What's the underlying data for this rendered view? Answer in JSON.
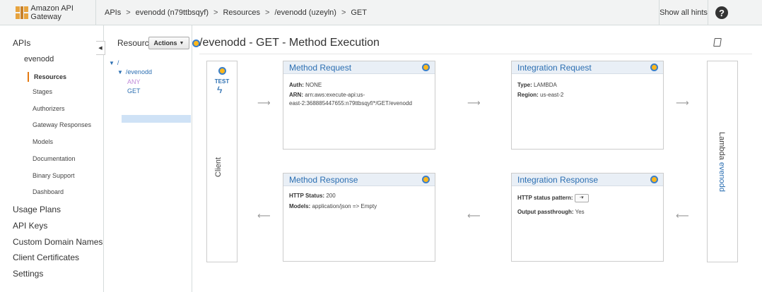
{
  "brand": {
    "name": "Amazon API Gateway",
    "icon": "api-gateway-icon"
  },
  "breadcrumb": [
    {
      "label": "APIs"
    },
    {
      "label": "evenodd (n79ttbsqyf)"
    },
    {
      "label": "Resources"
    },
    {
      "label": "/evenodd (uzeyln)"
    },
    {
      "label": "GET"
    }
  ],
  "breadcrumb_sep": ">",
  "header": {
    "hints_label": "Show all hints",
    "help_label": "?"
  },
  "nav": {
    "apis": "APIs",
    "api_name": "evenodd",
    "items": [
      "Resources",
      "Stages",
      "Authorizers",
      "Gateway Responses",
      "Models",
      "Documentation",
      "Binary Support",
      "Dashboard"
    ],
    "top_items": [
      "Usage Plans",
      "API Keys",
      "Custom Domain Names",
      "Client Certificates",
      "Settings"
    ]
  },
  "resources": {
    "title": "Resources",
    "actions_label": "Actions",
    "tree": {
      "root": "/",
      "child": "/evenodd",
      "methods": [
        "ANY",
        "GET"
      ]
    }
  },
  "main": {
    "title": "/evenodd - GET - Method Execution"
  },
  "client": {
    "test_label": "TEST",
    "label": "Client"
  },
  "method_request": {
    "title": "Method Request",
    "auth_key": "Auth:",
    "auth_val": "NONE",
    "arn_key": "ARN:",
    "arn_val1": "arn:aws:execute-api:us-",
    "arn_val2": "east-2:368885447655:n79ttbsqyf/*/GET/evenodd"
  },
  "integration_request": {
    "title": "Integration Request",
    "type_key": "Type:",
    "type_val": "LAMBDA",
    "region_key": "Region:",
    "region_val": "us-east-2"
  },
  "method_response": {
    "title": "Method Response",
    "status_key": "HTTP Status:",
    "status_val": "200",
    "models_key": "Models:",
    "models_val": "application/json => Empty"
  },
  "integration_response": {
    "title": "Integration Response",
    "pattern_key": "HTTP status pattern:",
    "pattern_val": "-",
    "passthrough_key": "Output passthrough:",
    "passthrough_val": "Yes"
  },
  "lambda": {
    "label": "Lambda",
    "function": "evenodd"
  },
  "colors": {
    "accent": "#2c6fb2",
    "orange": "#ffb71b",
    "highlight": "#cfe2f6"
  }
}
